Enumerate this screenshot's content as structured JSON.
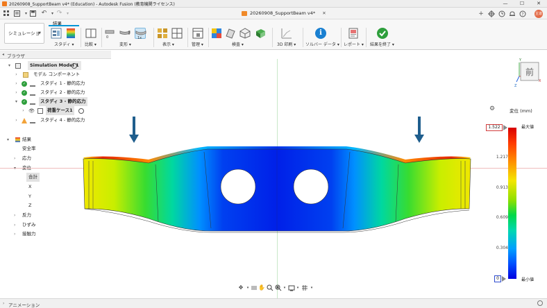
{
  "window": {
    "title": "20260908_SupportBeam v4* (Education) - Autodesk Fusion (教育機関ライセンス)",
    "minimize": "—",
    "maximize": "☐",
    "close": "✕"
  },
  "document": {
    "tab_title": "20260908_SupportBeam v4*"
  },
  "user": {
    "initials": "主道"
  },
  "ribbon": {
    "workspace": "シミュレーション",
    "active_tab": "結果",
    "groups": {
      "study": "スタディ",
      "compare": "比較",
      "deform": "変形",
      "display": "表示",
      "manage": "管理",
      "inspect": "検査",
      "print3d": "3D 印刷",
      "solver": "ソルバー データ",
      "report": "レポート",
      "finish": "結果を終了"
    },
    "deform_values": {
      "a": "0",
      "b": "1x"
    }
  },
  "browser": {
    "title": "ブラウザ",
    "items": [
      {
        "label": "Simulation Model 1"
      },
      {
        "label": "モデル コンポーネント"
      },
      {
        "label": "スタディ 1 - 静的応力"
      },
      {
        "label": "スタディ 2 - 静的応力"
      },
      {
        "label": "スタディ 3 - 静的応力"
      },
      {
        "label": "荷重ケース1"
      },
      {
        "label": "スタディ 4 - 静的応力"
      }
    ]
  },
  "results_tree": {
    "title": "結果",
    "items": [
      "安全率",
      "応力",
      "変位",
      "合計",
      "X",
      "Y",
      "Z",
      "反力",
      "ひずみ",
      "接触力"
    ]
  },
  "viewcube": {
    "face": "前",
    "axis_x": "X",
    "axis_y": "Y",
    "axis_z": "Z"
  },
  "legend": {
    "title": "変位 (mm)",
    "max_label": "最大値",
    "min_label": "最小値",
    "max_value": "1.522",
    "min_value": "0",
    "ticks": [
      "1.217",
      "0.913",
      "0.609",
      "0.304"
    ]
  },
  "animation": {
    "label": "アニメーション"
  },
  "colors": {
    "accent": "#0696d7",
    "warning": "#f2a33a",
    "ok": "#2e9f3c",
    "load_arrow": "#1f5e8d",
    "legend_max": "#d80000",
    "legend_min": "#0000e0"
  }
}
